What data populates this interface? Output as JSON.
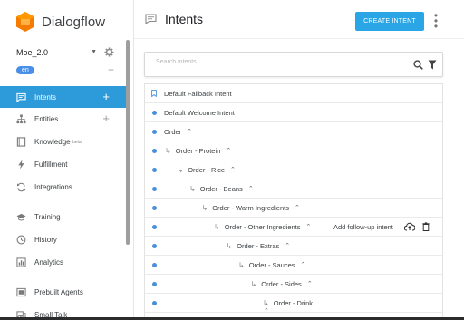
{
  "brand": {
    "name": "Dialogflow",
    "color": "#f57c00"
  },
  "agent": {
    "name": "Moe_2.0",
    "language": "en"
  },
  "nav": [
    {
      "key": "intents",
      "label": "Intents",
      "icon": "chat-bubble-icon",
      "active": true,
      "has_add": true
    },
    {
      "key": "entities",
      "label": "Entities",
      "icon": "hierarchy-icon",
      "active": false,
      "has_add": true
    },
    {
      "key": "knowledge",
      "label": "Knowledge",
      "badge": "[beta]",
      "icon": "book-icon"
    },
    {
      "key": "fulfillment",
      "label": "Fulfillment",
      "icon": "bolt-icon"
    },
    {
      "key": "integrations",
      "label": "Integrations",
      "icon": "sync-icon"
    },
    {
      "key": "training",
      "label": "Training",
      "icon": "graduation-cap-icon"
    },
    {
      "key": "history",
      "label": "History",
      "icon": "clock-icon"
    },
    {
      "key": "analytics",
      "label": "Analytics",
      "icon": "bar-chart-icon"
    },
    {
      "key": "prebuilt",
      "label": "Prebuilt Agents",
      "icon": "folder-icon"
    },
    {
      "key": "smalltalk",
      "label": "Small Talk",
      "icon": "smalltalk-icon"
    }
  ],
  "header": {
    "title": "Intents",
    "create_label": "CREATE INTENT",
    "more_label": "⋮"
  },
  "search": {
    "placeholder": "Search intents"
  },
  "intents": [
    {
      "label": "Default Fallback Intent",
      "type": "bookmark",
      "indent": 0
    },
    {
      "label": "Default Welcome Intent",
      "type": "dot",
      "indent": 0
    },
    {
      "label": "Order",
      "type": "dot",
      "indent": 0,
      "chevron": true
    },
    {
      "label": "Order - Protein",
      "type": "dot",
      "indent": 1,
      "chevron": true
    },
    {
      "label": "Order - Rice",
      "type": "dot",
      "indent": 2,
      "chevron": true
    },
    {
      "label": "Order - Beans",
      "type": "dot",
      "indent": 3,
      "chevron": true
    },
    {
      "label": "Order - Warm Ingredients",
      "type": "dot",
      "indent": 4,
      "chevron": true
    },
    {
      "label": "Order - Other Ingredients",
      "type": "dot",
      "indent": 5,
      "chevron": true,
      "hover": true
    },
    {
      "label": "Order - Extras",
      "type": "dot",
      "indent": 6,
      "chevron": true
    },
    {
      "label": "Order - Sauces",
      "type": "dot",
      "indent": 7,
      "chevron": true
    },
    {
      "label": "Order - Sides",
      "type": "dot",
      "indent": 8,
      "chevron": true
    },
    {
      "label": "Order - Drink",
      "type": "dot",
      "indent": 9,
      "chevron_below": true
    }
  ],
  "row_actions": {
    "followup_label": "Add follow-up intent"
  },
  "colors": {
    "accent": "#2d9bd9",
    "button": "#2aa6e6",
    "dot": "#4a90d9",
    "lang_pill": "#4a8fe7"
  }
}
